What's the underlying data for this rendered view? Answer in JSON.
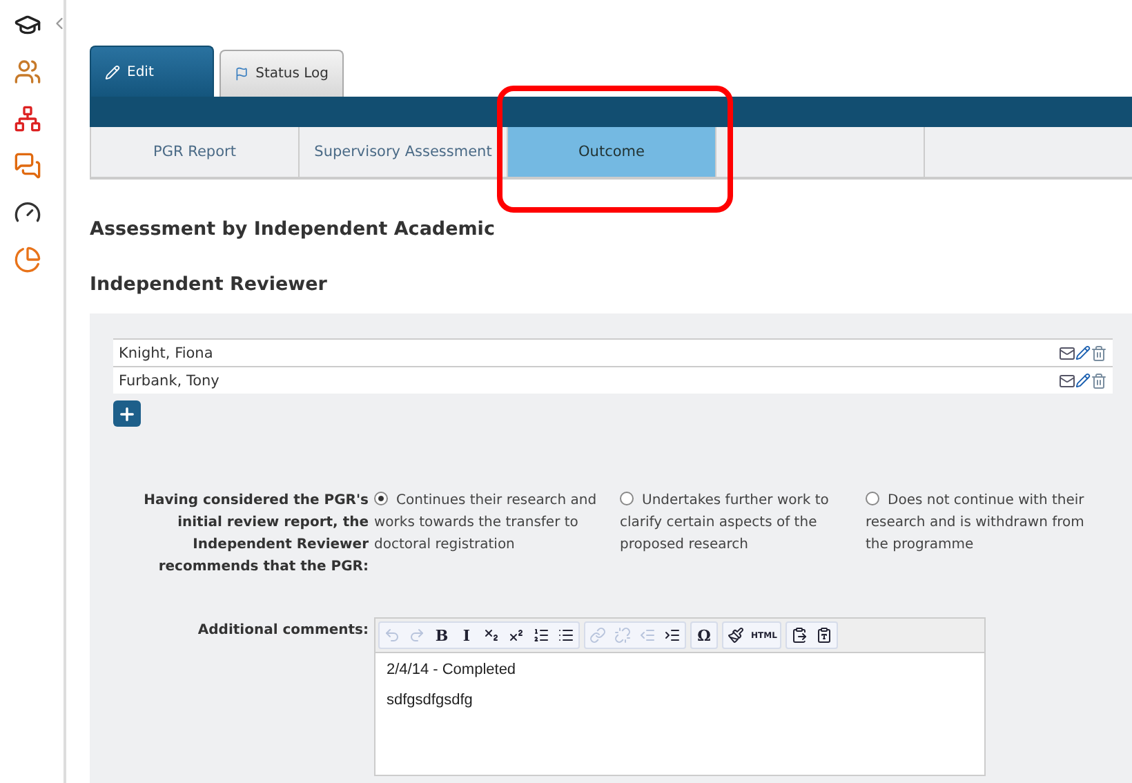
{
  "tabs": [
    {
      "label": "Edit",
      "selected": true
    },
    {
      "label": "Status Log",
      "selected": false
    }
  ],
  "subtabs": [
    {
      "label": "PGR Report",
      "selected": false
    },
    {
      "label": "Supervisory Assessment",
      "selected": false
    },
    {
      "label": "Outcome",
      "selected": true
    },
    {
      "selected": false
    },
    {
      "selected": false
    }
  ],
  "heading": "Assessment by Independent Academic",
  "subheading": "Independent Reviewer",
  "reviewers": [
    {
      "name": "Knight, Fiona"
    },
    {
      "name": "Furbank, Tony"
    }
  ],
  "recommendation": {
    "label": "Having considered the PGR's initial review report, the Independent Reviewer recommends that the PGR:",
    "options": [
      {
        "label": "Continues their research and works towards the transfer to doctoral registration",
        "selected": true
      },
      {
        "label": "Undertakes further work to clarify certain aspects of the proposed research",
        "selected": false
      },
      {
        "label": "Does not continue with their research and is withdrawn from the programme",
        "selected": false
      }
    ]
  },
  "comments": {
    "label": "Additional comments:",
    "toolbar": [
      [
        {
          "kind": "icon",
          "disabled": true
        },
        {
          "kind": "icon",
          "disabled": true
        },
        {
          "kind": "glyph",
          "label": "B",
          "disabled": false
        },
        {
          "kind": "glyph",
          "label": "I",
          "disabled": false
        },
        {
          "kind": "icon",
          "disabled": false
        },
        {
          "kind": "icon",
          "disabled": false
        },
        {
          "kind": "icon",
          "disabled": false
        },
        {
          "kind": "icon",
          "disabled": false
        }
      ],
      [
        {
          "kind": "icon",
          "disabled": true
        },
        {
          "kind": "icon",
          "disabled": true
        },
        {
          "kind": "icon",
          "disabled": true
        },
        {
          "kind": "icon",
          "disabled": false
        }
      ],
      [
        {
          "kind": "glyph",
          "label": "Ω",
          "disabled": false
        }
      ],
      [
        {
          "kind": "icon",
          "disabled": false
        },
        {
          "kind": "glyph",
          "label": "HTML",
          "disabled": false
        }
      ],
      [
        {
          "kind": "icon",
          "disabled": false
        },
        {
          "kind": "icon",
          "disabled": false
        }
      ]
    ],
    "lines": [
      "2/4/14 - Completed",
      "sdfgsdfgsdfg"
    ]
  }
}
